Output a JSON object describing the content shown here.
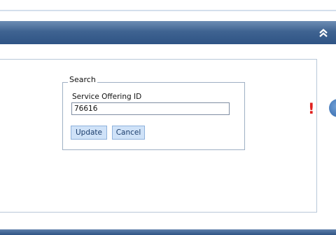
{
  "search": {
    "legend": "Search",
    "field_label": "Service Offering ID",
    "field_value": "76616",
    "update_label": "Update",
    "cancel_label": "Cancel"
  },
  "indicators": {
    "alert_text": "!"
  },
  "icons": {
    "collapse": "double-chevron-up-icon",
    "alert": "exclamation-icon",
    "nav": "circular-arrow-button-icon"
  },
  "colors": {
    "header": "#2f5485",
    "button_bg": "#cfe2f8",
    "alert": "#e0211f"
  }
}
